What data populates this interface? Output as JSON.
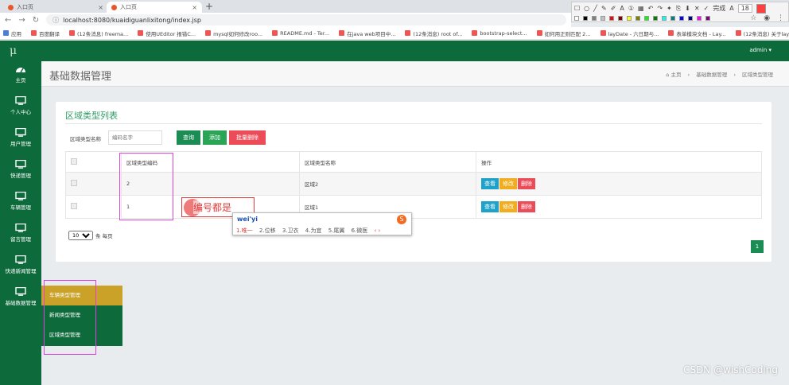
{
  "browser": {
    "tabs": [
      {
        "label": "入口页"
      },
      {
        "label": "入口页"
      }
    ],
    "new_tab": "+",
    "url": "localhost:8080/kuaidiguanlixitong/index.jsp",
    "bookmarks": [
      "应用",
      "百度翻译",
      "(12条消息) freema...",
      "使用UEditor 报错C...",
      "mysql如何修改roo...",
      "README.md - Ter...",
      "在java web项目中...",
      "(12条消息) root of...",
      "bootstrap-select...",
      "如何用正则匹配 2...",
      "layDate - 六日期与...",
      "表单模块文档 - Lay...",
      "(12条消息) 关于lay..."
    ],
    "draw_toolbar": {
      "font_size": "18",
      "finish": "完成"
    },
    "colors": [
      "#ffffff",
      "#000000",
      "#808080",
      "#c0c0c0",
      "#ff0000",
      "#800000",
      "#ffff00",
      "#808000",
      "#00ff00",
      "#008000",
      "#00ffff",
      "#008080",
      "#0000ff",
      "#000080",
      "#ff00ff",
      "#800080"
    ]
  },
  "topbar": {
    "logo": "μ",
    "user": "admin ▾"
  },
  "sidebar": {
    "items": [
      {
        "label": "主页",
        "icon": "dashboard-icon"
      },
      {
        "label": "个人中心",
        "icon": "monitor-icon"
      },
      {
        "label": "用户管理",
        "icon": "monitor-icon"
      },
      {
        "label": "快递管理",
        "icon": "monitor-icon"
      },
      {
        "label": "车辆管理",
        "icon": "monitor-icon"
      },
      {
        "label": "留言管理",
        "icon": "monitor-icon"
      },
      {
        "label": "快递新闻管理",
        "icon": "monitor-icon"
      },
      {
        "label": "基础数据管理",
        "icon": "monitor-icon"
      }
    ],
    "submenu": [
      "车辆类型管理",
      "新闻类型管理",
      "区域类型管理"
    ]
  },
  "page": {
    "title": "基础数据管理",
    "breadcrumb": [
      "⌂ 主页",
      "基础数据管理",
      "区域类型管理"
    ]
  },
  "panel": {
    "title": "区域类型列表",
    "search_label": "区域类型名称",
    "search_placeholder": "编码名字",
    "buttons": {
      "query": "查询",
      "add": "添加",
      "batch_delete": "批量删除"
    },
    "table": {
      "headers": [
        "区域类型编码",
        "区域类型名称",
        "操作"
      ],
      "rows": [
        {
          "code": "2",
          "name": "区域2"
        },
        {
          "code": "1",
          "name": "区域1"
        }
      ],
      "actions": {
        "view": "查看",
        "edit": "修改",
        "delete": "删除"
      }
    },
    "page_size": "10",
    "page_size_suffix": "条 每页",
    "current_page": "1"
  },
  "ime": {
    "composing": "编号都是",
    "pinyin": "wei'yi",
    "logo": "S",
    "candidates": [
      "1.唯一",
      "2.位移",
      "3.卫衣",
      "4.为宜",
      "5.尾翼",
      "6.微医"
    ],
    "nav": "‹ ›"
  },
  "watermark": "CSDN @wishCoding"
}
